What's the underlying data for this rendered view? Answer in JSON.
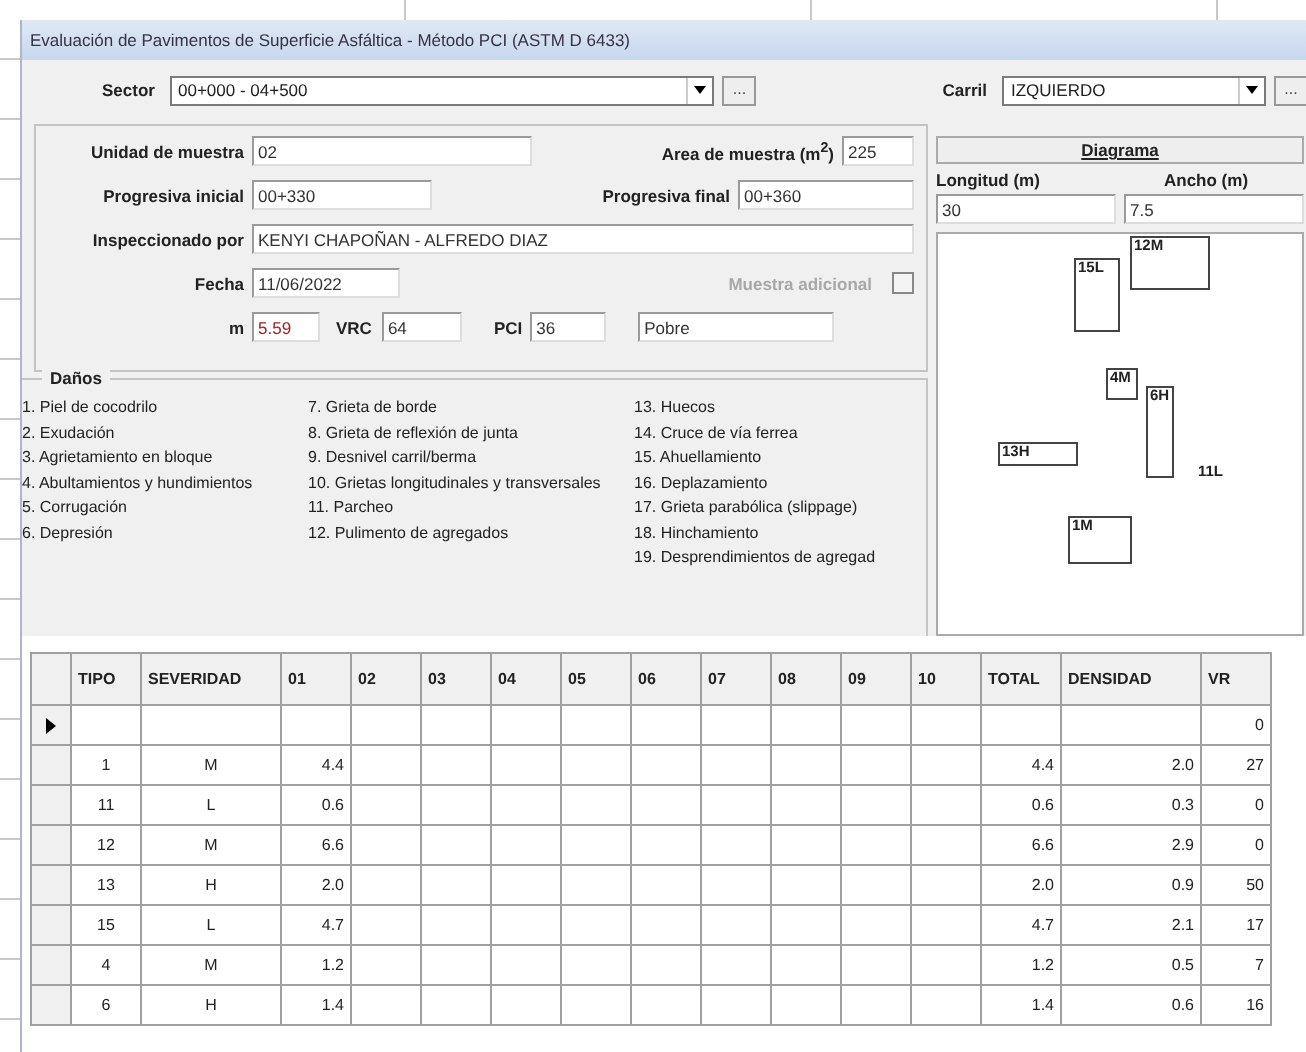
{
  "window": {
    "title": "Evaluación de Pavimentos de Superficie Asfáltica - Método PCI (ASTM D 6433)"
  },
  "sector": {
    "label": "Sector",
    "value": "00+000 - 04+500",
    "more": "..."
  },
  "carril": {
    "label": "Carril",
    "value": "IZQUIERDO",
    "more": "..."
  },
  "form": {
    "unidad": {
      "label": "Unidad de muestra",
      "value": "02"
    },
    "area": {
      "label": "Area de muestra (m$^{2}$)",
      "value": "225"
    },
    "prog_inicial": {
      "label": "Progresiva inicial",
      "value": "00+330"
    },
    "prog_final": {
      "label": "Progresiva final",
      "value": "00+360"
    },
    "inspector": {
      "label": "Inspeccionado por",
      "value": "KENYI CHAPOÑAN - ALFREDO DIAZ"
    },
    "fecha": {
      "label": "Fecha",
      "value": "11/06/2022"
    },
    "muestra_adicional": {
      "label": "Muestra adicional",
      "disabled": true,
      "checked": false
    },
    "m": {
      "label": "m",
      "value": "5.59"
    },
    "vrc": {
      "label": "VRC",
      "value": "64"
    },
    "pci": {
      "label": "PCI",
      "value": "36"
    },
    "condicion": {
      "value": "Pobre"
    }
  },
  "diagram": {
    "button": "Diagrama",
    "longitud": {
      "label": "Longitud (m)",
      "value": "30"
    },
    "ancho": {
      "label": "Ancho (m)",
      "value": "7.5"
    },
    "marks": [
      {
        "label": "15L",
        "kind": "box"
      },
      {
        "label": "12M",
        "kind": "box"
      },
      {
        "label": "4M",
        "kind": "box"
      },
      {
        "label": "6H",
        "kind": "box"
      },
      {
        "label": "13H",
        "kind": "box"
      },
      {
        "label": "11L",
        "kind": "text"
      },
      {
        "label": "1M",
        "kind": "box"
      }
    ]
  },
  "danos": {
    "title": "Daños",
    "columns": [
      [
        "1. Piel de cocodrilo",
        "2. Exudación",
        "3. Agrietamiento en bloque",
        "4. Abultamientos y hundimientos",
        "5. Corrugación",
        "6. Depresión"
      ],
      [
        "7. Grieta de borde",
        "8. Grieta de reflexión de junta",
        "9. Desnivel carril/berma",
        "10. Grietas longitudinales y transversales",
        "11. Parcheo",
        "12. Pulimento de agregados"
      ],
      [
        "13. Huecos",
        "14. Cruce de vía ferrea",
        "15. Ahuellamiento",
        "16. Deplazamiento",
        "17. Grieta parabólica (slippage)",
        "18. Hinchamiento",
        "19. Desprendimientos de agregad"
      ]
    ]
  },
  "table": {
    "columns": [
      "TIPO",
      "SEVERIDAD",
      "01",
      "02",
      "03",
      "04",
      "05",
      "06",
      "07",
      "08",
      "09",
      "10",
      "TOTAL",
      "DENSIDAD",
      "VR"
    ],
    "rows": [
      {
        "current": true,
        "cells": [
          "",
          "",
          "",
          "",
          "",
          "",
          "",
          "",
          "",
          "",
          "",
          "",
          "",
          "",
          "0"
        ]
      },
      {
        "current": false,
        "cells": [
          "1",
          "M",
          "4.4",
          "",
          "",
          "",
          "",
          "",
          "",
          "",
          "",
          "",
          "4.4",
          "2.0",
          "27"
        ]
      },
      {
        "current": false,
        "cells": [
          "11",
          "L",
          "0.6",
          "",
          "",
          "",
          "",
          "",
          "",
          "",
          "",
          "",
          "0.6",
          "0.3",
          "0"
        ]
      },
      {
        "current": false,
        "cells": [
          "12",
          "M",
          "6.6",
          "",
          "",
          "",
          "",
          "",
          "",
          "",
          "",
          "",
          "6.6",
          "2.9",
          "0"
        ]
      },
      {
        "current": false,
        "cells": [
          "13",
          "H",
          "2.0",
          "",
          "",
          "",
          "",
          "",
          "",
          "",
          "",
          "",
          "2.0",
          "0.9",
          "50"
        ]
      },
      {
        "current": false,
        "cells": [
          "15",
          "L",
          "4.7",
          "",
          "",
          "",
          "",
          "",
          "",
          "",
          "",
          "",
          "4.7",
          "2.1",
          "17"
        ]
      },
      {
        "current": false,
        "cells": [
          "4",
          "M",
          "1.2",
          "",
          "",
          "",
          "",
          "",
          "",
          "",
          "",
          "",
          "1.2",
          "0.5",
          "7"
        ]
      },
      {
        "current": false,
        "cells": [
          "6",
          "H",
          "1.4",
          "",
          "",
          "",
          "",
          "",
          "",
          "",
          "",
          "",
          "1.4",
          "0.6",
          "16"
        ]
      }
    ]
  }
}
